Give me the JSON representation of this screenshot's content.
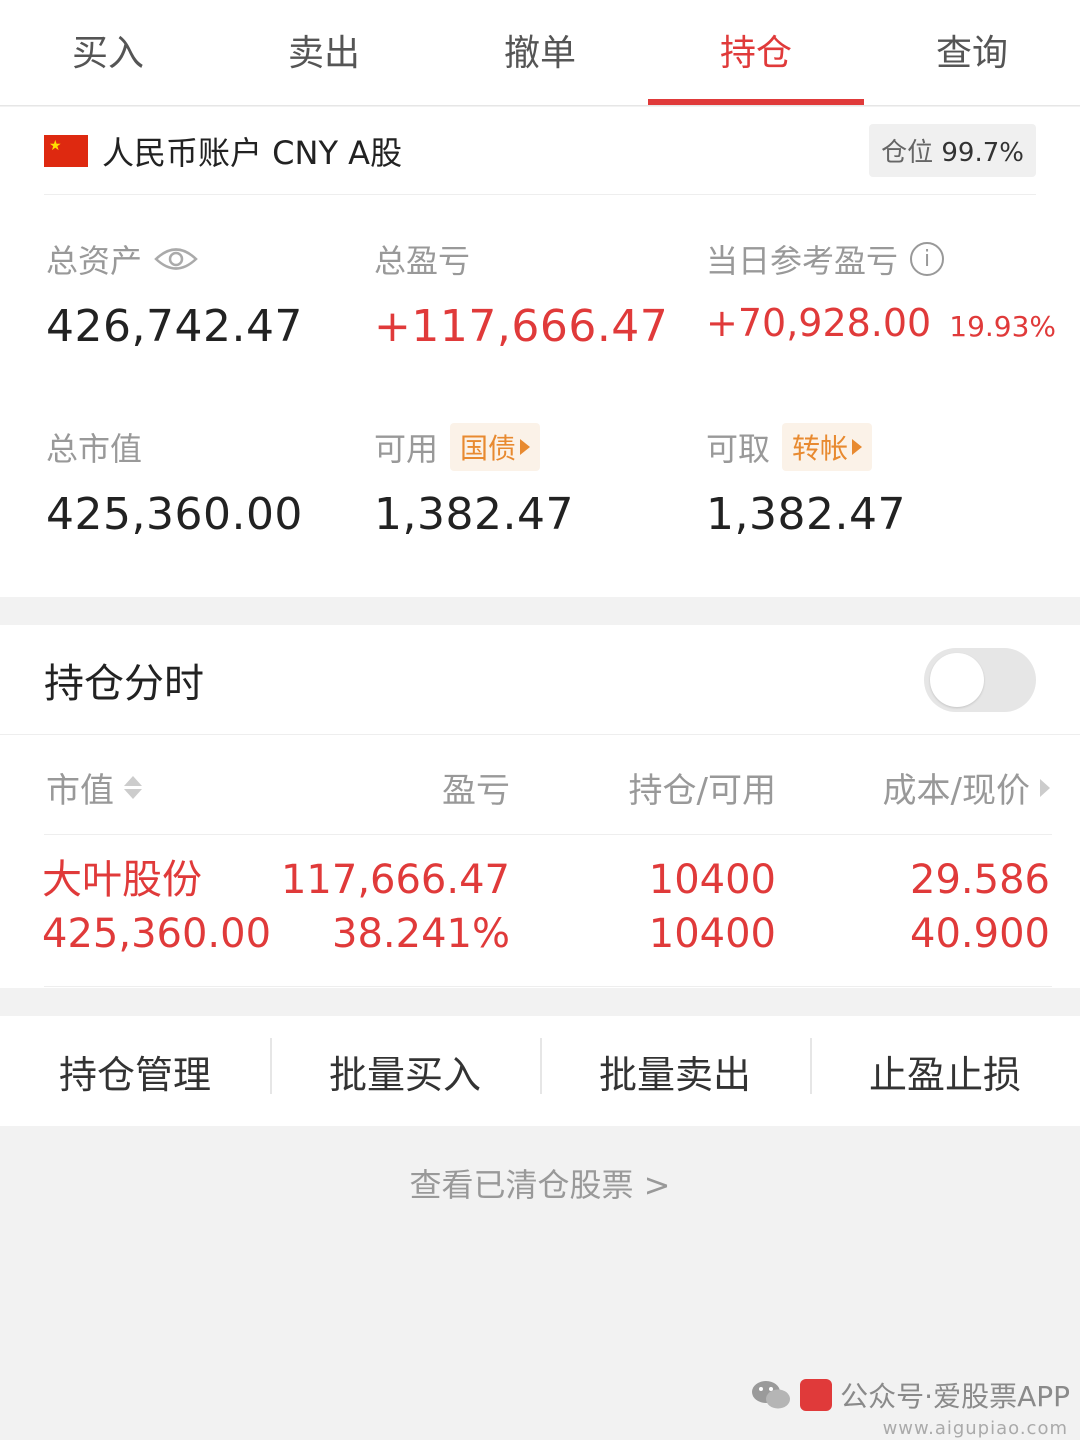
{
  "tabs": [
    "买入",
    "卖出",
    "撤单",
    "持仓",
    "查询"
  ],
  "active_tab": "持仓",
  "account": {
    "name": "人民币账户 CNY A股",
    "position_label": "仓位",
    "position_value": "99.7%"
  },
  "stats": {
    "total_assets_label": "总资产",
    "total_assets": "426,742.47",
    "total_pnl_label": "总盈亏",
    "total_pnl": "+117,666.47",
    "today_pnl_label": "当日参考盈亏",
    "today_pnl": "+70,928.00",
    "today_pnl_pct": "19.93%",
    "market_value_label": "总市值",
    "market_value": "425,360.00",
    "available_label": "可用",
    "available_tag": "国债",
    "available": "1,382.47",
    "withdrawable_label": "可取",
    "withdrawable_tag": "转帐",
    "withdrawable": "1,382.47"
  },
  "holdings": {
    "title": "持仓分时",
    "toggle_on": false,
    "columns": [
      "市值",
      "盈亏",
      "持仓/可用",
      "成本/现价"
    ],
    "rows": [
      {
        "name": "大叶股份",
        "market_value": "425,360.00",
        "pnl": "117,666.47",
        "pnl_pct": "38.241%",
        "position": "10400",
        "available": "10400",
        "cost": "29.586",
        "price": "40.900"
      }
    ]
  },
  "actions": [
    "持仓管理",
    "批量买入",
    "批量卖出",
    "止盈止损"
  ],
  "cleared_link": "查看已清仓股票 >",
  "watermark": {
    "text": "公众号·爱股票APP",
    "site": "www.aigupiao.com"
  },
  "colors": {
    "accent_red": "#e03a3a",
    "tag_orange": "#e88a30"
  }
}
